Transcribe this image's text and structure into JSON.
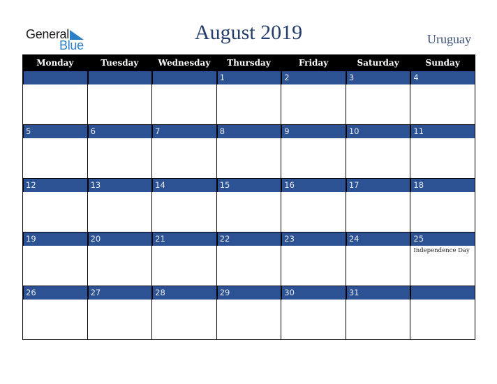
{
  "logo": {
    "word1": "General",
    "word2": "Blue"
  },
  "header": {
    "title": "August 2019",
    "country": "Uruguay"
  },
  "colors": {
    "header_bg": "#000000",
    "date_strip": "#2c5293",
    "title": "#253d6b",
    "logo_blue": "#2a7fc6"
  },
  "weekdays": [
    "Monday",
    "Tuesday",
    "Wednesday",
    "Thursday",
    "Friday",
    "Saturday",
    "Sunday"
  ],
  "weeks": [
    [
      {
        "day": ""
      },
      {
        "day": ""
      },
      {
        "day": ""
      },
      {
        "day": "1"
      },
      {
        "day": "2"
      },
      {
        "day": "3"
      },
      {
        "day": "4"
      }
    ],
    [
      {
        "day": "5"
      },
      {
        "day": "6"
      },
      {
        "day": "7"
      },
      {
        "day": "8"
      },
      {
        "day": "9"
      },
      {
        "day": "10"
      },
      {
        "day": "11"
      }
    ],
    [
      {
        "day": "12"
      },
      {
        "day": "13"
      },
      {
        "day": "14"
      },
      {
        "day": "15"
      },
      {
        "day": "16"
      },
      {
        "day": "17"
      },
      {
        "day": "18"
      }
    ],
    [
      {
        "day": "19"
      },
      {
        "day": "20"
      },
      {
        "day": "21"
      },
      {
        "day": "22"
      },
      {
        "day": "23"
      },
      {
        "day": "24"
      },
      {
        "day": "25",
        "event": "Independence Day"
      }
    ],
    [
      {
        "day": "26"
      },
      {
        "day": "27"
      },
      {
        "day": "28"
      },
      {
        "day": "29"
      },
      {
        "day": "30"
      },
      {
        "day": "31"
      },
      {
        "day": ""
      }
    ]
  ]
}
